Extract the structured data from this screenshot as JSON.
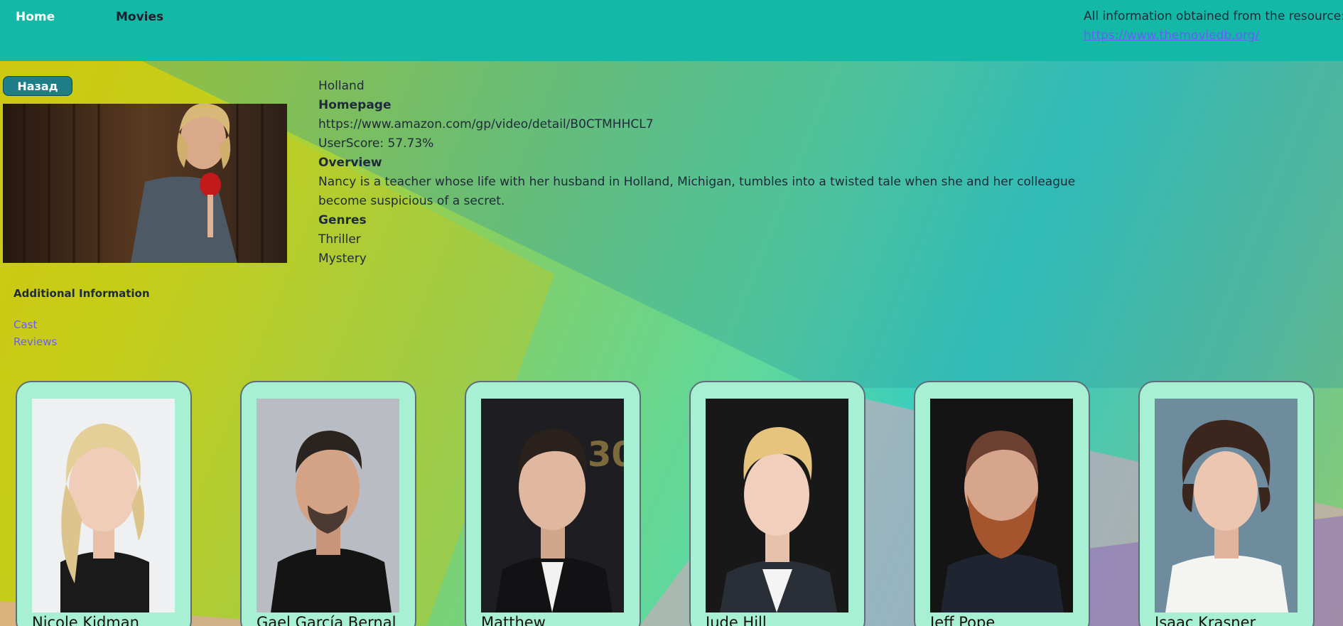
{
  "header": {
    "nav": {
      "home": "Home",
      "movies": "Movies"
    },
    "source_label": "All information obtained from the resource:",
    "source_link": "https://www.themoviedb.org/"
  },
  "back_button": "Назад",
  "movie": {
    "title": "Holland",
    "homepage_label": "Homepage",
    "homepage": "https://www.amazon.com/gp/video/detail/B0CTMHHCL7",
    "user_score": "UserScore: 57.73%",
    "overview_label": "Overview",
    "overview": "Nancy is a teacher whose life with her husband in Holland, Michigan, tumbles into a twisted tale when she and her colleague become suspicious of a secret.",
    "genres_label": "Genres",
    "genres": [
      "Thriller",
      "Mystery"
    ]
  },
  "additional_info": {
    "title": "Additional Information",
    "links": {
      "cast": "Cast",
      "reviews": "Reviews"
    }
  },
  "cast": [
    {
      "name": "Nicole Kidman"
    },
    {
      "name": "Gael García Bernal"
    },
    {
      "name": "Matthew"
    },
    {
      "name": "Jude Hill"
    },
    {
      "name": "Jeff Pope"
    },
    {
      "name": "Isaac Krasner"
    }
  ],
  "colors": {
    "header_bg": "#13b8a6",
    "button_bg": "#1e7d87",
    "card_bg": "#a7f0d4",
    "link": "#6a5cff"
  }
}
